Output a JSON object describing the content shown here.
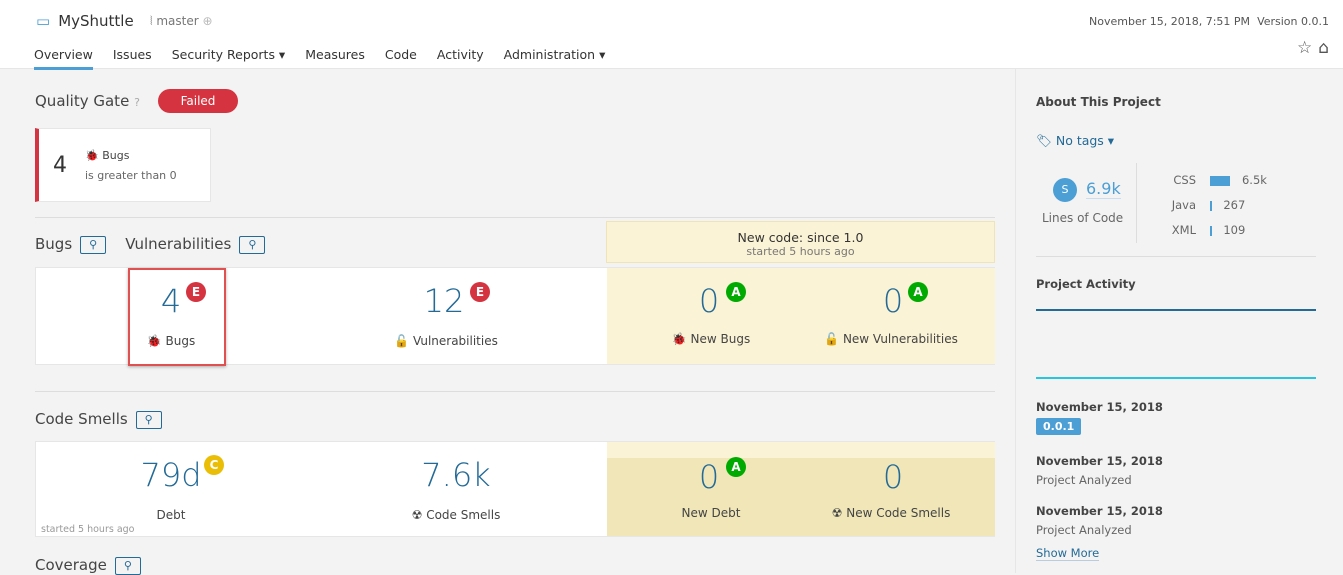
{
  "header": {
    "project": "MyShuttle",
    "branch": "master",
    "datetime": "November 15, 2018, 7:51 PM",
    "version": "Version 0.0.1"
  },
  "nav": [
    {
      "label": "Overview",
      "active": true
    },
    {
      "label": "Issues"
    },
    {
      "label": "Security Reports ▾"
    },
    {
      "label": "Measures"
    },
    {
      "label": "Code"
    },
    {
      "label": "Activity"
    },
    {
      "label": "Administration ▾"
    }
  ],
  "quality_gate": {
    "title": "Quality Gate",
    "status": "Failed",
    "status_color": "#d4333f",
    "condition": {
      "value": "4",
      "metric": "Bugs",
      "rule": "is greater than 0"
    }
  },
  "bugs_section": {
    "bugs_title": "Bugs",
    "vuln_title": "Vulnerabilities",
    "new_code_title": "New code: since 1.0",
    "new_code_sub": "started 5 hours ago",
    "bugs": {
      "value": "4",
      "rating": "E",
      "label": "Bugs"
    },
    "vulns": {
      "value": "12",
      "rating": "E",
      "label": "Vulnerabilities"
    },
    "new_bugs": {
      "value": "0",
      "rating": "A",
      "label": "New Bugs"
    },
    "new_vulns": {
      "value": "0",
      "rating": "A",
      "label": "New Vulnerabilities"
    }
  },
  "smells_section": {
    "title": "Code Smells",
    "debt": {
      "value": "79d",
      "rating": "C",
      "label": "Debt"
    },
    "started": "started 5 hours ago",
    "smells": {
      "value": "7.6k",
      "label": "Code Smells"
    },
    "new_debt": {
      "value": "0",
      "rating": "A",
      "label": "New Debt"
    },
    "new_smells": {
      "value": "0",
      "label": "New Code Smells"
    }
  },
  "coverage_title": "Coverage",
  "about": {
    "title": "About This Project",
    "tags": "No tags ▾",
    "loc_size": "S",
    "loc": "6.9k",
    "loc_label": "Lines of Code",
    "languages": [
      {
        "name": "CSS",
        "value": "6.5k",
        "fraction": 0.94
      },
      {
        "name": "Java",
        "value": "267",
        "fraction": 0.04
      },
      {
        "name": "XML",
        "value": "109",
        "fraction": 0.02
      }
    ]
  },
  "activity": {
    "title": "Project Activity",
    "events": [
      {
        "date": "November 15, 2018",
        "badge": "0.0.1"
      },
      {
        "date": "November 15, 2018",
        "text": "Project Analyzed"
      },
      {
        "date": "November 15, 2018",
        "text": "Project Analyzed"
      }
    ],
    "show_more": "Show More"
  }
}
